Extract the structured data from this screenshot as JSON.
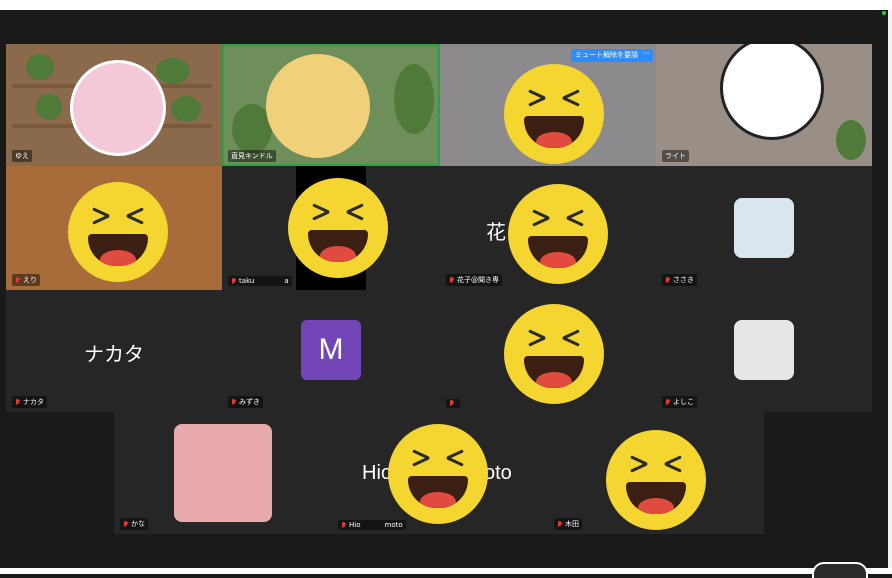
{
  "participants": {
    "yue": "ゆえ",
    "naomi": "直見キンドル",
    "hanako_row1": "",
    "light": "ライト",
    "eri": "えり",
    "taku": "taku",
    "taku_suffix": "a",
    "hanako": "花子@聞き専",
    "sasaki": "ささき",
    "nakata": "ナカタ",
    "mizuki": "みずき",
    "row3_col3": "",
    "yoshiko": "よしこ",
    "kana": "かな",
    "hio": "Hio",
    "hio_suffix": "moto",
    "kida": "木田"
  },
  "big_names": {
    "hana_partial": "花",
    "nakata": "ナカタ",
    "hio_left": "Hio",
    "hio_right": "oto",
    "m_initial": "M"
  },
  "controls": {
    "mute_label": "ミュート解除を要請",
    "more_label": "···"
  },
  "colors": {
    "tile_bg": "#262626",
    "active_outline": "#2ea043",
    "accent": "#2d8cff",
    "emoji_face": "#f5d630",
    "m_avatar": "#7346b8"
  },
  "icons": [
    "muted-mic-icon",
    "laughing-emoji-icon",
    "more-icon"
  ]
}
